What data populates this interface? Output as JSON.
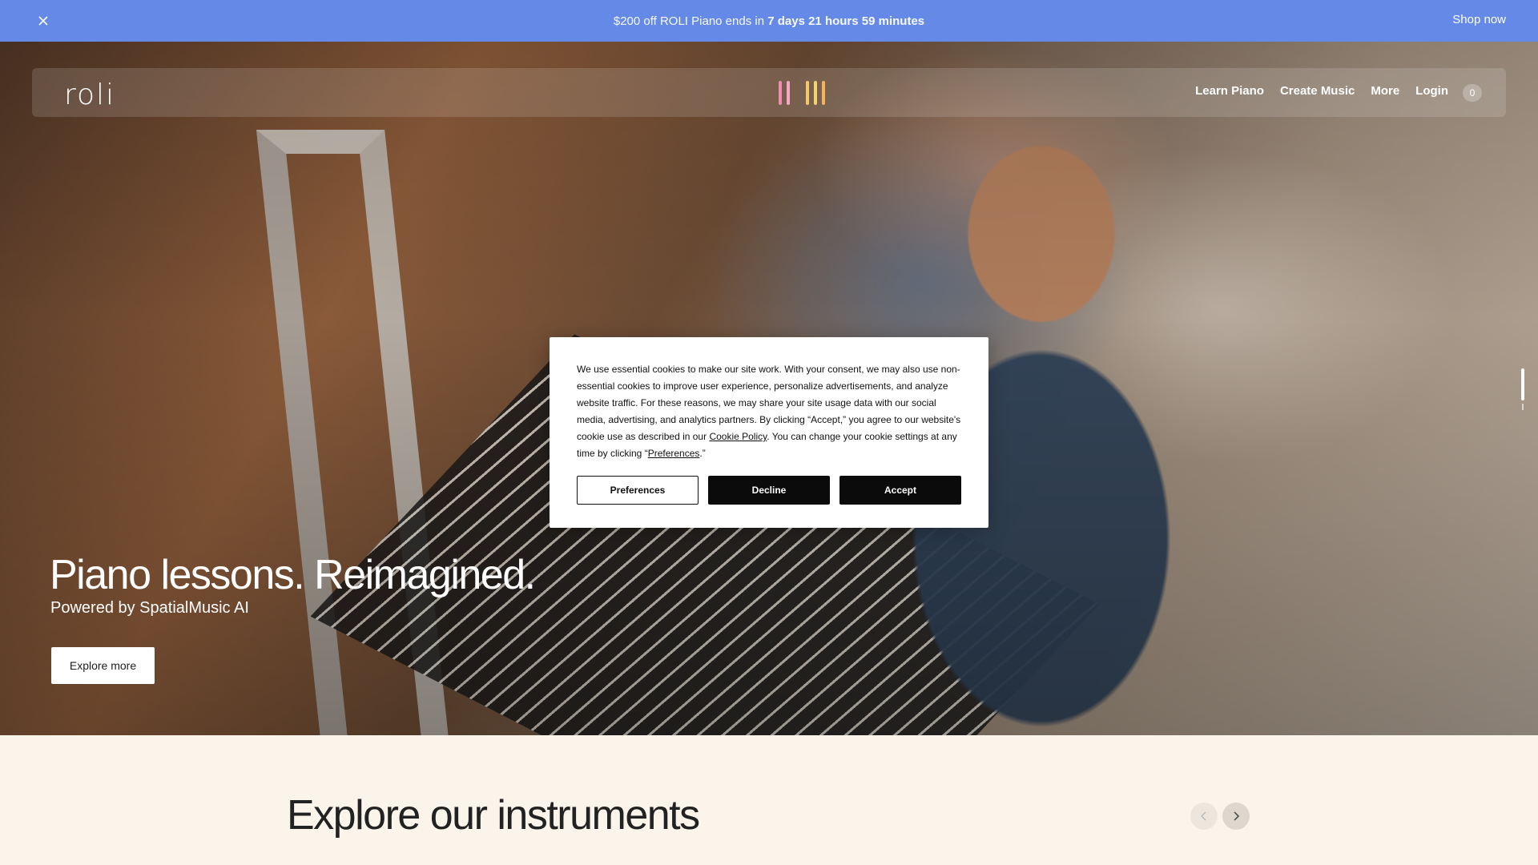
{
  "promo": {
    "message_prefix": "$200 off ROLI Piano ends in ",
    "countdown": "7 days 21 hours 59 minutes",
    "cta": "Shop now",
    "background": "#6489e6"
  },
  "nav": {
    "logo": "roli",
    "links": [
      "Learn Piano",
      "Create Music",
      "More",
      "Login"
    ],
    "cart_count": "0",
    "bar_colors": [
      "#f28cb0",
      "#f2a6c8",
      "#f5c86b",
      "#f6d36e",
      "#f4b35a"
    ]
  },
  "hero": {
    "headline": "Piano lessons. Reimagined.",
    "subline": "Powered by SpatialMusic AI",
    "cta": "Explore more"
  },
  "cookie": {
    "text_1": "We use essential cookies to make our site work. With your consent, we may also use non-essential cookies to improve user experience, personalize advertisements, and analyze website traffic. For these reasons, we may share your site usage data with our social media, advertising, and analytics partners. By clicking “Accept,” you agree to our website's cookie use as described in our ",
    "policy_link": "Cookie Policy",
    "text_2": ". You can change your cookie settings at any time by clicking “",
    "preferences_link": "Preferences",
    "text_3": ".”",
    "buttons": {
      "preferences": "Preferences",
      "decline": "Decline",
      "accept": "Accept"
    }
  },
  "section": {
    "title": "Explore our instruments",
    "prev_icon": "chevron-left-icon",
    "next_icon": "chevron-right-icon"
  }
}
